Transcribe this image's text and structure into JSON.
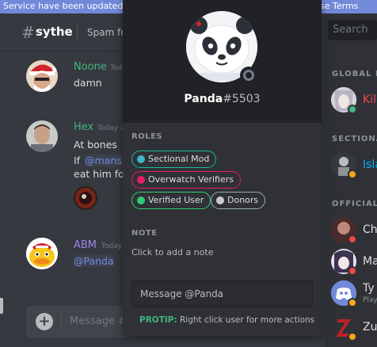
{
  "banner": {
    "text_left": "Service have been updated",
    "text_right": "se Terms"
  },
  "channel": {
    "hash": "#",
    "name": "sythe",
    "topic": "Spam fo"
  },
  "messages": [
    {
      "user": "Noone",
      "timestamp": "Tod",
      "text": "damn",
      "color": "#43b581"
    },
    {
      "user": "Hex",
      "timestamp": "Today a",
      "lines": [
        "At bones",
        "If",
        "@mans r",
        "eat him for"
      ],
      "color": "#43b581"
    },
    {
      "user": "ABM",
      "timestamp": "Today at",
      "text": "@Panda",
      "color": "#9b84ec"
    }
  ],
  "chat_input": {
    "plus": "+",
    "placeholder": "Message #s"
  },
  "members": {
    "search_placeholder": "Search",
    "sections": [
      "GLOBAL M",
      "SECTIONA",
      "OFFICIAL"
    ],
    "items": [
      {
        "name": "Kil",
        "color": "#f04747",
        "status_color": "#43b581"
      },
      {
        "name": "Isla",
        "color": "#00b0f4",
        "status_color": "#faa61a"
      },
      {
        "name": "Ch",
        "color": "#dcddde",
        "status_color": "#f04747"
      },
      {
        "name": "Ma",
        "color": "#dcddde",
        "status_color": "#f04747"
      },
      {
        "name": "Ty",
        "sub": "Playi",
        "color": "#dcddde",
        "status_color": "#faa61a"
      },
      {
        "name": "Zu",
        "color": "#dcddde",
        "status_color": "#faa61a"
      }
    ]
  },
  "profile": {
    "name": "Panda",
    "discriminator": "#5503",
    "roles_label": "ROLES",
    "roles": [
      {
        "name": "Sectional Mod",
        "color": "#1abc9c",
        "dot": "#3fb5c7"
      },
      {
        "name": "Overwatch Verifiers",
        "color": "#e91e63",
        "dot": "#e91e63"
      },
      {
        "name": "Verified User",
        "color": "#2ecc71",
        "dot": "#2ecc71"
      },
      {
        "name": "Donors",
        "color": "#99aab5",
        "dot": "#c7ccd1"
      }
    ],
    "note_label": "NOTE",
    "note_placeholder": "Click to add a note",
    "message_placeholder": "Message @Panda",
    "protip_label": "PROTIP:",
    "protip_text": " Right click user for more actions"
  }
}
